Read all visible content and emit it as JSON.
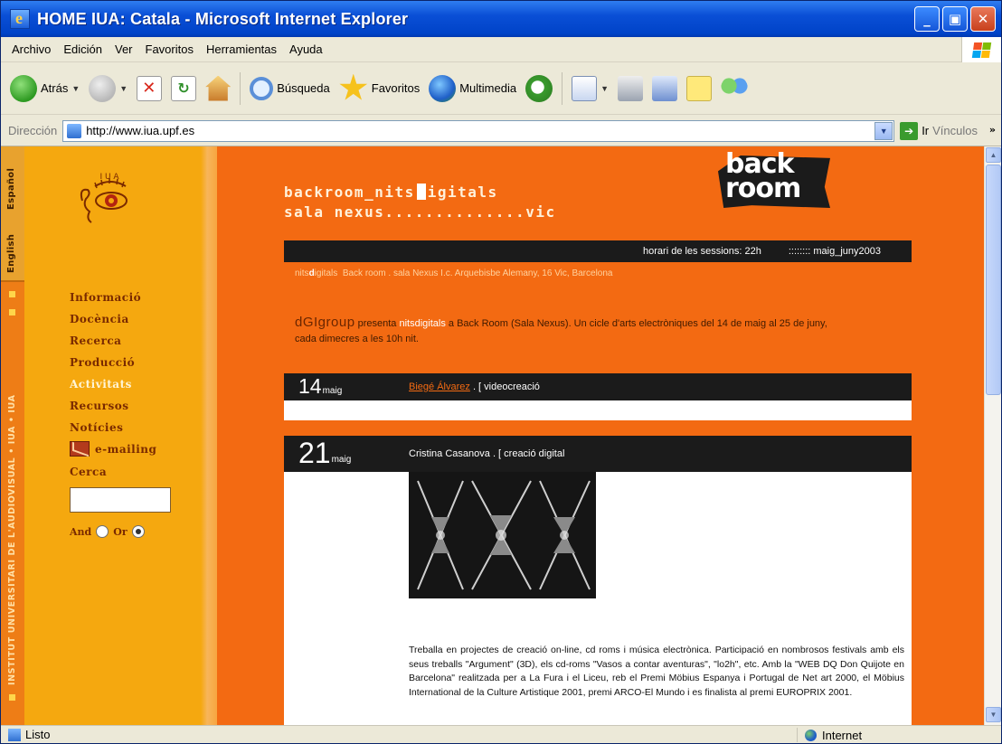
{
  "window": {
    "title": "HOME IUA: Catala - Microsoft Internet Explorer"
  },
  "menu": [
    "Archivo",
    "Edición",
    "Ver",
    "Favoritos",
    "Herramientas",
    "Ayuda"
  ],
  "toolbar": {
    "back": "Atrás",
    "search": "Búsqueda",
    "favorites": "Favoritos",
    "media": "Multimedia"
  },
  "address": {
    "label": "Dirección",
    "url": "http://www.iua.upf.es",
    "go": "Ir",
    "links": "Vínculos"
  },
  "lang_tabs": {
    "english": "English",
    "spanish": "Español"
  },
  "org_name": "INSTITUT UNIVERSITARI DE L'AUDIOVISUAL • IUA • IUA",
  "logo_text": "I U A",
  "nav": [
    "Informació",
    "Docència",
    "Recerca",
    "Producció",
    "Activitats",
    "Recursos",
    "Notícies"
  ],
  "emailing": "e-mailing",
  "search": {
    "label": "Cerca",
    "and": "And",
    "or": "Or"
  },
  "header": {
    "line1a": "backroom_nits",
    "line1b": "igitals",
    "line2": "sala nexus..............vic",
    "logo_line1": "back",
    "logo_line2": "room"
  },
  "bar": {
    "hours": "horari de les sessions: 22h",
    "dates": ":::::::: maig_juny2003"
  },
  "nits_line": {
    "brand_a": "nits",
    "brand_b": "d",
    "brand_c": "igitals",
    "rest": "Back room . sala Nexus I.c. Arquebisbe Alemany, 16 Vic, Barcelona"
  },
  "intro": {
    "group": "dGIgroup",
    "presenta": "presenta",
    "brand": "nitsdigitals",
    "text": "a Back Room (Sala Nexus). Un cicle d'arts electròniques del 14 de maig al 25 de juny, cada dimecres a les 10h nit."
  },
  "events": [
    {
      "day": "14",
      "month": "maig",
      "artist": "Biegé Álvarez",
      "kind": ". [ videocreació"
    },
    {
      "day": "21",
      "month": "maig",
      "artist": "Cristina Casanova",
      "kind": ". [ creació digital"
    }
  ],
  "bio": "Treballa en projectes de creació on-line, cd roms i música electrònica. Participació en nombrosos festivals amb els seus treballs \"Argument\" (3D), els cd-roms \"Vasos a contar aventuras\", \"lo2h\", etc. Amb la \"WEB DQ Don Quijote en Barcelona\" realitzada per a La Fura i el Liceu, reb el Premi Möbius Espanya i Portugal de Net art 2000, el Möbius International de la Culture Artistique 2001, premi ARCO-El Mundo i es finalista al premi EUROPRIX 2001.",
  "status": {
    "text": "Listo",
    "zone": "Internet"
  },
  "colors": {
    "page_orange": "#f36a12",
    "sidebar_yellow": "#f5a80f",
    "dark_bar": "#1b1b1b",
    "xp_blue": "#0a4fd6"
  }
}
